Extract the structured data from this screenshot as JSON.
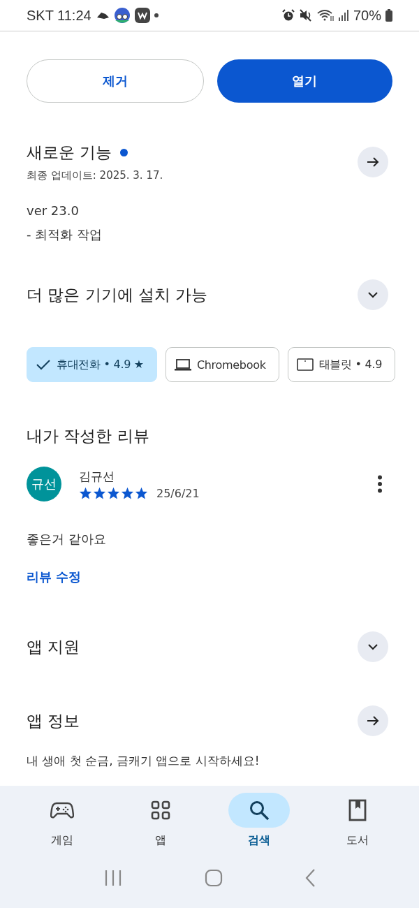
{
  "status_bar": {
    "carrier": "SKT",
    "time": "11:24",
    "battery": "70%"
  },
  "actions": [
    {
      "label": "제거",
      "kind": "outline"
    },
    {
      "label": "열기",
      "kind": "filled"
    }
  ],
  "whats_new": {
    "title": "새로운 기능",
    "new": true,
    "updated": "최종 업데이트: 2025. 3. 17.",
    "notes": [
      "ver 23.0",
      "- 최적화 작업"
    ]
  },
  "devices": {
    "title": "더 많은 기기에 설치 가능",
    "expanded": false,
    "chips": [
      {
        "label": "휴대전화 • 4.9 ★",
        "selected": true
      },
      {
        "label": "Chromebook",
        "kind": "laptop",
        "selected": false
      },
      {
        "label": "태블릿 • 4.9",
        "kind": "tablet",
        "selected": false
      }
    ]
  },
  "review": {
    "title": "내가 작성한 리뷰",
    "avatar": "규선",
    "author": "김규선",
    "stars": 5,
    "date": "25/6/21",
    "text": "좋은거 같아요",
    "edit_link": "리뷰 수정"
  },
  "sections": [
    {
      "title": "앱 지원",
      "kind": "expand",
      "expanded": false
    },
    {
      "title": "앱 정보",
      "kind": "arrow"
    }
  ],
  "promo": "내 생애 첫 순금, 금캐기 앱으로 시작하세요!",
  "nav": [
    {
      "label": "게임",
      "kind": "game",
      "selected": false
    },
    {
      "label": "앱",
      "kind": "apps",
      "selected": false
    },
    {
      "label": "검색",
      "kind": "search",
      "selected": true
    },
    {
      "label": "도서",
      "kind": "book",
      "selected": false
    }
  ]
}
